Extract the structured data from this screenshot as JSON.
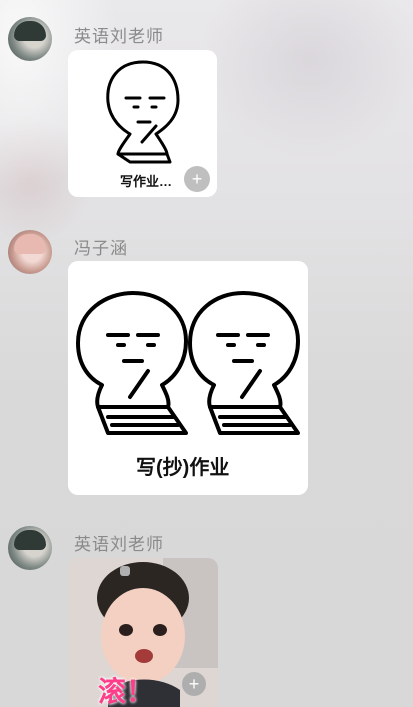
{
  "messages": [
    {
      "sender": "英语刘老师",
      "sticker_caption": "写作业…",
      "badge_icon": "zoom-plus-icon"
    },
    {
      "sender": "冯子涵",
      "sticker_caption": "写(抄)作业"
    },
    {
      "sender": "英语刘老师",
      "photo_caption": "滚！",
      "badge_icon": "plus-icon"
    }
  ]
}
